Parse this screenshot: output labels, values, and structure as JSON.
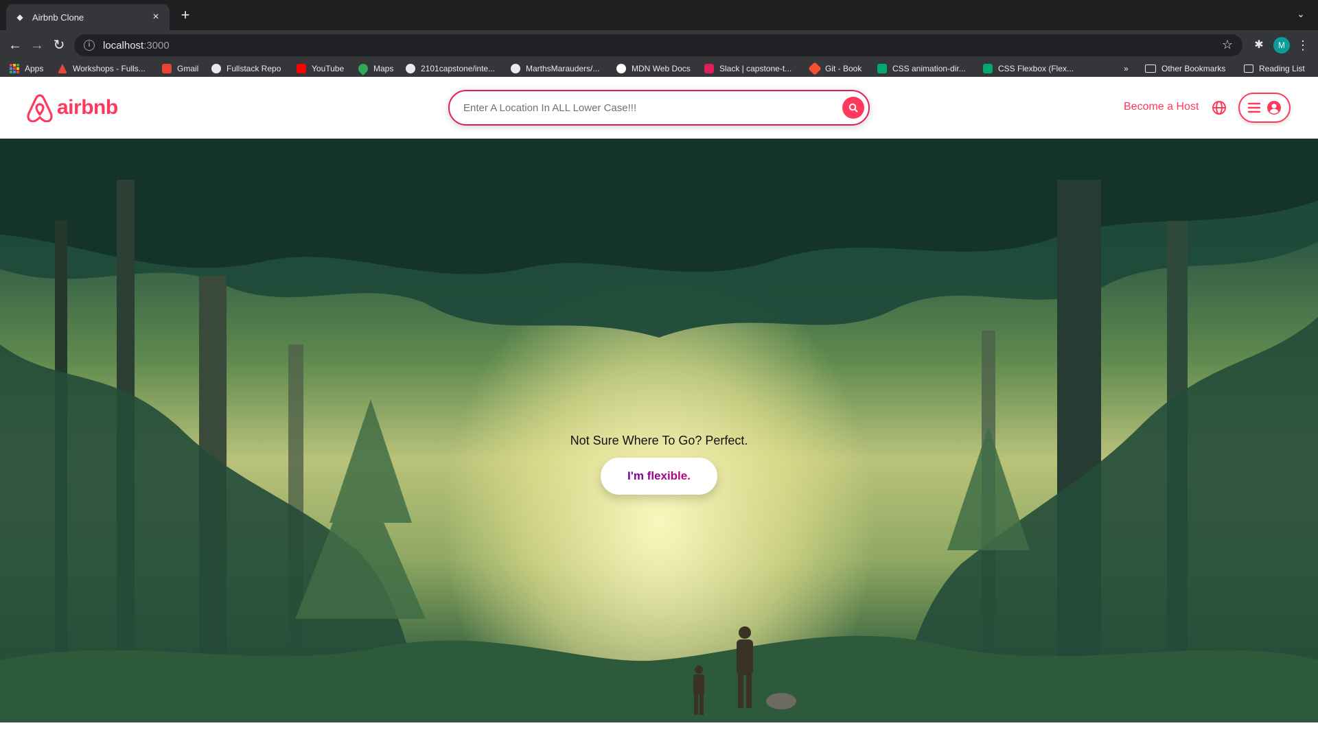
{
  "browser": {
    "tab_title": "Airbnb Clone",
    "new_tab": "+",
    "url_host": "localhost",
    "url_port": ":3000",
    "profile_initial": "M",
    "bookmarks": [
      {
        "label": "Apps",
        "icon": "apps-grid-icon"
      },
      {
        "label": "Workshops - Fulls...",
        "icon": "fullstack-icon"
      },
      {
        "label": "Gmail",
        "icon": "gmail-icon"
      },
      {
        "label": "Fullstack Repo",
        "icon": "github-icon"
      },
      {
        "label": "YouTube",
        "icon": "youtube-icon"
      },
      {
        "label": "Maps",
        "icon": "maps-icon"
      },
      {
        "label": "2101capstone/inte...",
        "icon": "github-icon"
      },
      {
        "label": "MarthsMarauders/...",
        "icon": "github-icon"
      },
      {
        "label": "MDN Web Docs",
        "icon": "mdn-icon"
      },
      {
        "label": "Slack | capstone-t...",
        "icon": "slack-icon"
      },
      {
        "label": "Git - Book",
        "icon": "git-icon"
      },
      {
        "label": "CSS animation-dir...",
        "icon": "w3schools-icon"
      },
      {
        "label": "CSS Flexbox (Flex...",
        "icon": "w3schools-icon"
      }
    ],
    "overflow": "»",
    "other_bookmarks": "Other Bookmarks",
    "reading_list": "Reading List"
  },
  "header": {
    "logo_text": "airbnb",
    "search_placeholder": "Enter A Location In ALL Lower Case!!!",
    "become_host": "Become a Host"
  },
  "hero": {
    "heading": "Not Sure Where To Go? Perfect.",
    "button_label": "I'm flexible."
  },
  "colors": {
    "brand": "#ff385c",
    "search_border": "#e31c5f",
    "button_gradient_start": "#6f019c",
    "button_gradient_end": "#c6017e"
  }
}
